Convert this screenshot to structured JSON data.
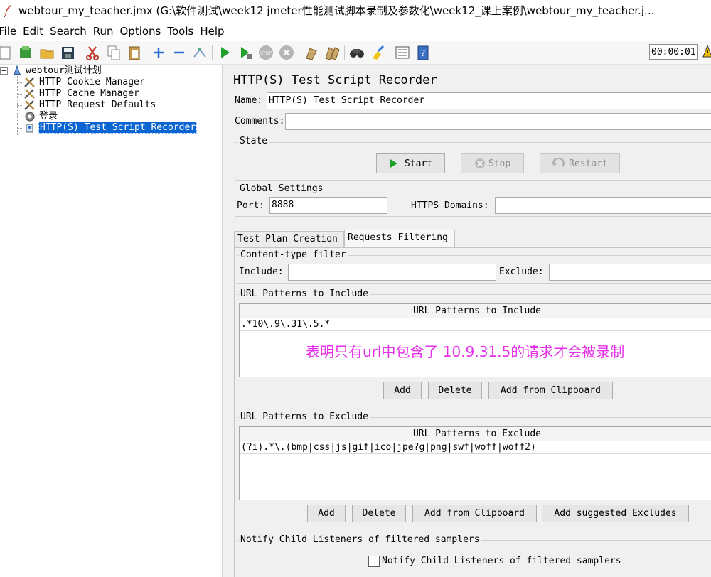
{
  "window": {
    "title": "webtour_my_teacher.jmx (G:\\软件测试\\week12 jmeter性能测试脚本录制及参数化\\week12_课上案例\\webtour_my_teacher.j..."
  },
  "menu": [
    "File",
    "Edit",
    "Search",
    "Run",
    "Options",
    "Tools",
    "Help"
  ],
  "toolbar": {
    "icons": [
      "new-icon",
      "templates-icon",
      "open-icon",
      "save-icon",
      "cut-icon",
      "copy-icon",
      "paste-icon",
      "expand-icon",
      "collapse-icon",
      "toggle-icon",
      "start-icon",
      "start-no-pauses-icon",
      "stop-icon",
      "shutdown-icon",
      "clear-icon",
      "clear-all-icon",
      "search-icon",
      "reset-search-icon",
      "function-helper-icon",
      "help-icon"
    ],
    "timer": "00:00:01"
  },
  "tree": {
    "items": [
      {
        "label": "webtour测试计划"
      },
      {
        "label": "HTTP Cookie Manager"
      },
      {
        "label": "HTTP Cache Manager"
      },
      {
        "label": "HTTP Request Defaults"
      },
      {
        "label": "登录"
      },
      {
        "label": "HTTP(S) Test Script Recorder"
      }
    ]
  },
  "panel": {
    "title": "HTTP(S) Test Script Recorder",
    "name_label": "Name:",
    "name_value": "HTTP(S) Test Script Recorder",
    "comments_label": "Comments:",
    "comments_value": "",
    "state": {
      "title": "State",
      "start": "Start",
      "stop": "Stop",
      "restart": "Restart"
    },
    "global": {
      "title": "Global Settings",
      "port_label": "Port:",
      "port_value": "8888",
      "https_label": "HTTPS Domains:",
      "https_value": ""
    },
    "tabs": [
      "Test Plan Creation",
      "Requests Filtering"
    ],
    "content_type": {
      "title": "Content-type filter",
      "include_label": "Include:",
      "include_value": "",
      "exclude_label": "Exclude:",
      "exclude_value": ""
    },
    "include_patterns": {
      "title": "URL Patterns to Include",
      "header": "URL Patterns to Include",
      "rows": [
        ".*10\\.9\\.31\\.5.*"
      ],
      "add": "Add",
      "delete": "Delete",
      "add_clipboard": "Add from Clipboard"
    },
    "annotation": "表明只有url中包含了 10.9.31.5的请求才会被录制",
    "exclude_patterns": {
      "title": "URL Patterns to Exclude",
      "header": "URL Patterns to Exclude",
      "rows": [
        "(?i).*\\.(bmp|css|js|gif|ico|jpe?g|png|swf|woff|woff2)"
      ],
      "add": "Add",
      "delete": "Delete",
      "add_clipboard": "Add from Clipboard",
      "add_suggested": "Add suggested Excludes"
    },
    "notify": {
      "title": "Notify Child Listeners of filtered samplers",
      "checkbox_label": "Notify Child Listeners of filtered samplers",
      "checked": false
    }
  },
  "colors": {
    "selection": "#0a64d2",
    "annotation": "#e531e8",
    "panel_bg": "#f0f0f0"
  }
}
